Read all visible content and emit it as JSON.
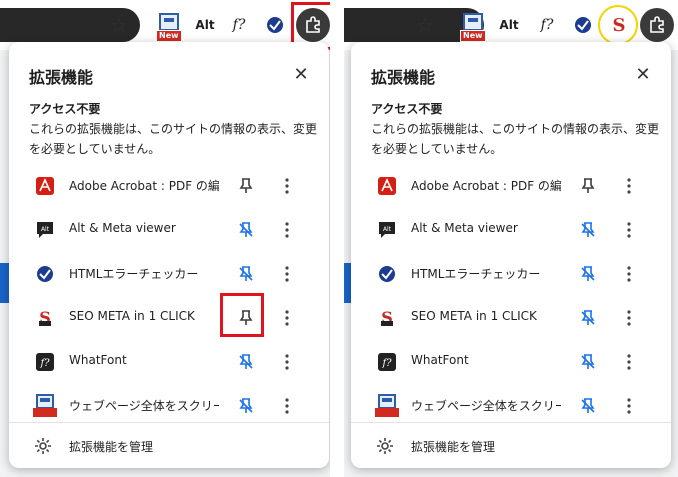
{
  "panel": {
    "title": "拡張機能",
    "section_heading": "アクセス不要",
    "section_description": "これらの拡張機能は、このサイトの情報の表示、変更を必要としていません。",
    "manage_label": "拡張機能を管理"
  },
  "toolbar": {
    "new_badge": "New",
    "alt_icon_text": "Alt",
    "font_icon_text": "f?",
    "seo_icon_text": "S"
  },
  "extensions": [
    {
      "name": "Adobe Acrobat : PDF の編…",
      "pinned": true
    },
    {
      "name": "Alt & Meta viewer",
      "pinned": false
    },
    {
      "name": "HTMLエラーチェッカー",
      "pinned": false
    },
    {
      "name": "SEO META in 1 CLICK",
      "pinned": true
    },
    {
      "name": "WhatFont",
      "pinned": false
    },
    {
      "name": "ウェブページ全体をスクリーンシ…",
      "pinned": false
    }
  ],
  "extensions_after": [
    {
      "name": "Adobe Acrobat : PDF の編…",
      "pinned": true
    },
    {
      "name": "Alt & Meta viewer",
      "pinned": false
    },
    {
      "name": "HTMLエラーチェッカー",
      "pinned": false
    },
    {
      "name": "SEO META in 1 CLICK",
      "pinned": false
    },
    {
      "name": "WhatFont",
      "pinned": false
    },
    {
      "name": "ウェブページ全体をスクリーンシ…",
      "pinned": false
    }
  ],
  "colors": {
    "pinned_icon": "#3c3c3c",
    "unpinned_icon": "#1a73e8",
    "highlight_box": "#e0141e",
    "highlight_circle": "#f5d400"
  }
}
